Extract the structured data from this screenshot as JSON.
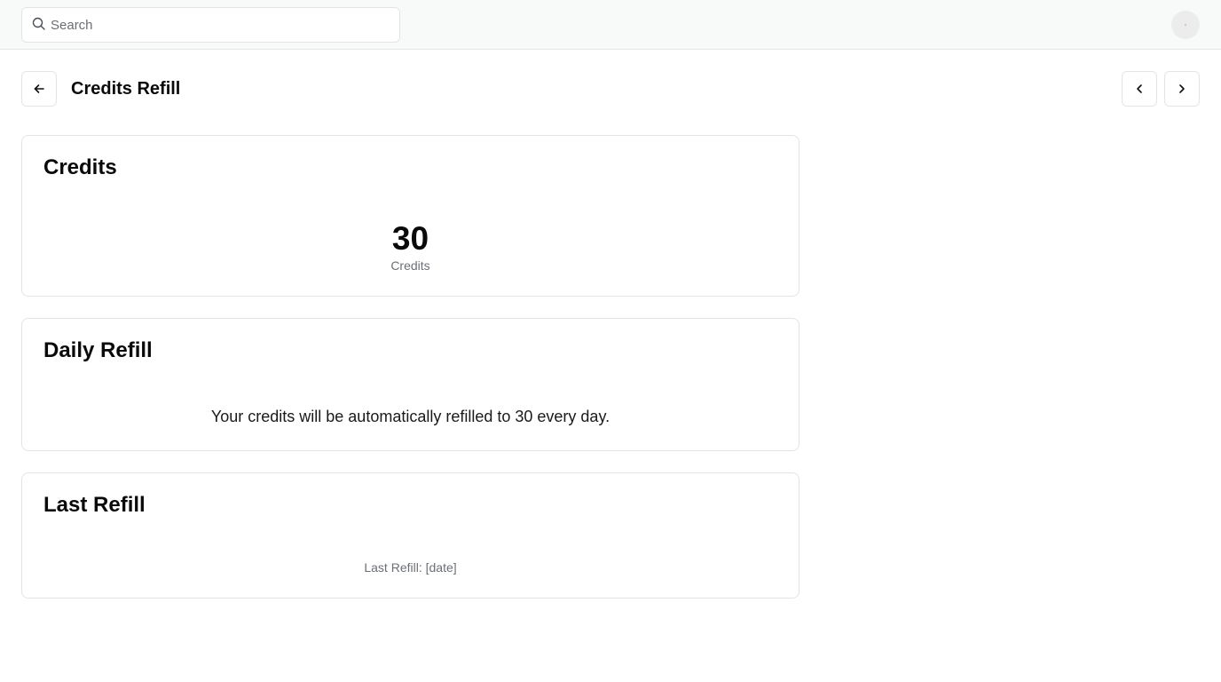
{
  "topbar": {
    "search_placeholder": "Search",
    "search_value": "",
    "search_icon": "search-icon",
    "avatar": "user-avatar"
  },
  "header": {
    "title": "Credits Refill",
    "back_icon": "arrow-left-icon",
    "prev_icon": "chevron-left-icon",
    "next_icon": "chevron-right-icon"
  },
  "credits_card": {
    "title": "Credits",
    "value": "30",
    "unit": "Credits"
  },
  "daily_refill_card": {
    "title": "Daily Refill",
    "text": "Your credits will be automatically refilled to 30 every day."
  },
  "last_refill_card": {
    "title": "Last Refill",
    "text": "Last Refill: [date]"
  },
  "colors": {
    "topbar_background": "#f8faf9",
    "border": "#e2e4e6",
    "muted_text": "#6b6f75",
    "primary_text": "#0a0a0a"
  }
}
